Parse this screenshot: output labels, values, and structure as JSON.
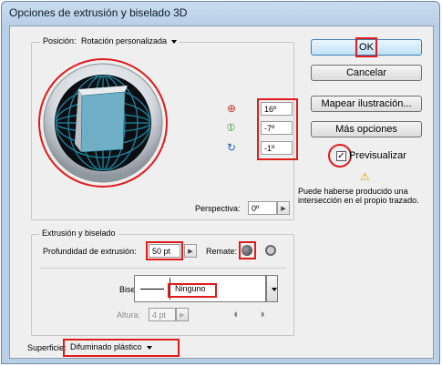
{
  "window": {
    "title": "Opciones de extrusión y biselado 3D"
  },
  "position": {
    "label": "Posición:",
    "value": "Rotación personalizada",
    "rot_x": "16º",
    "rot_y": "-7º",
    "rot_z": "-1º",
    "perspective_label": "Perspectiva:",
    "perspective_value": "0º"
  },
  "buttons": {
    "ok": "OK",
    "cancel": "Cancelar",
    "map": "Mapear ilustración...",
    "more": "Más opciones"
  },
  "preview": {
    "label": "Previsualizar",
    "checked": true
  },
  "warning": {
    "text": "Puede haberse producido una intersección en el propio trazado."
  },
  "extrude": {
    "group_label": "Extrusión y biselado",
    "depth_label": "Profundidad de extrusión:",
    "depth_value": "50 pt",
    "cap_label": "Remate:",
    "bevel_label": "Bisel:",
    "bevel_value": "Ninguno",
    "height_label": "Altura:",
    "height_value": "4 pt"
  },
  "surface": {
    "label": "Superficie:",
    "value": "Difuminado plástico"
  },
  "colors": {
    "highlight": "#e01b1b",
    "cube_front": "#6fb0c6",
    "grid": "#1f8fa8",
    "sphere": "#0b0f14",
    "titlebar": "#c9dcef",
    "dialog_bg": "#efefef"
  }
}
